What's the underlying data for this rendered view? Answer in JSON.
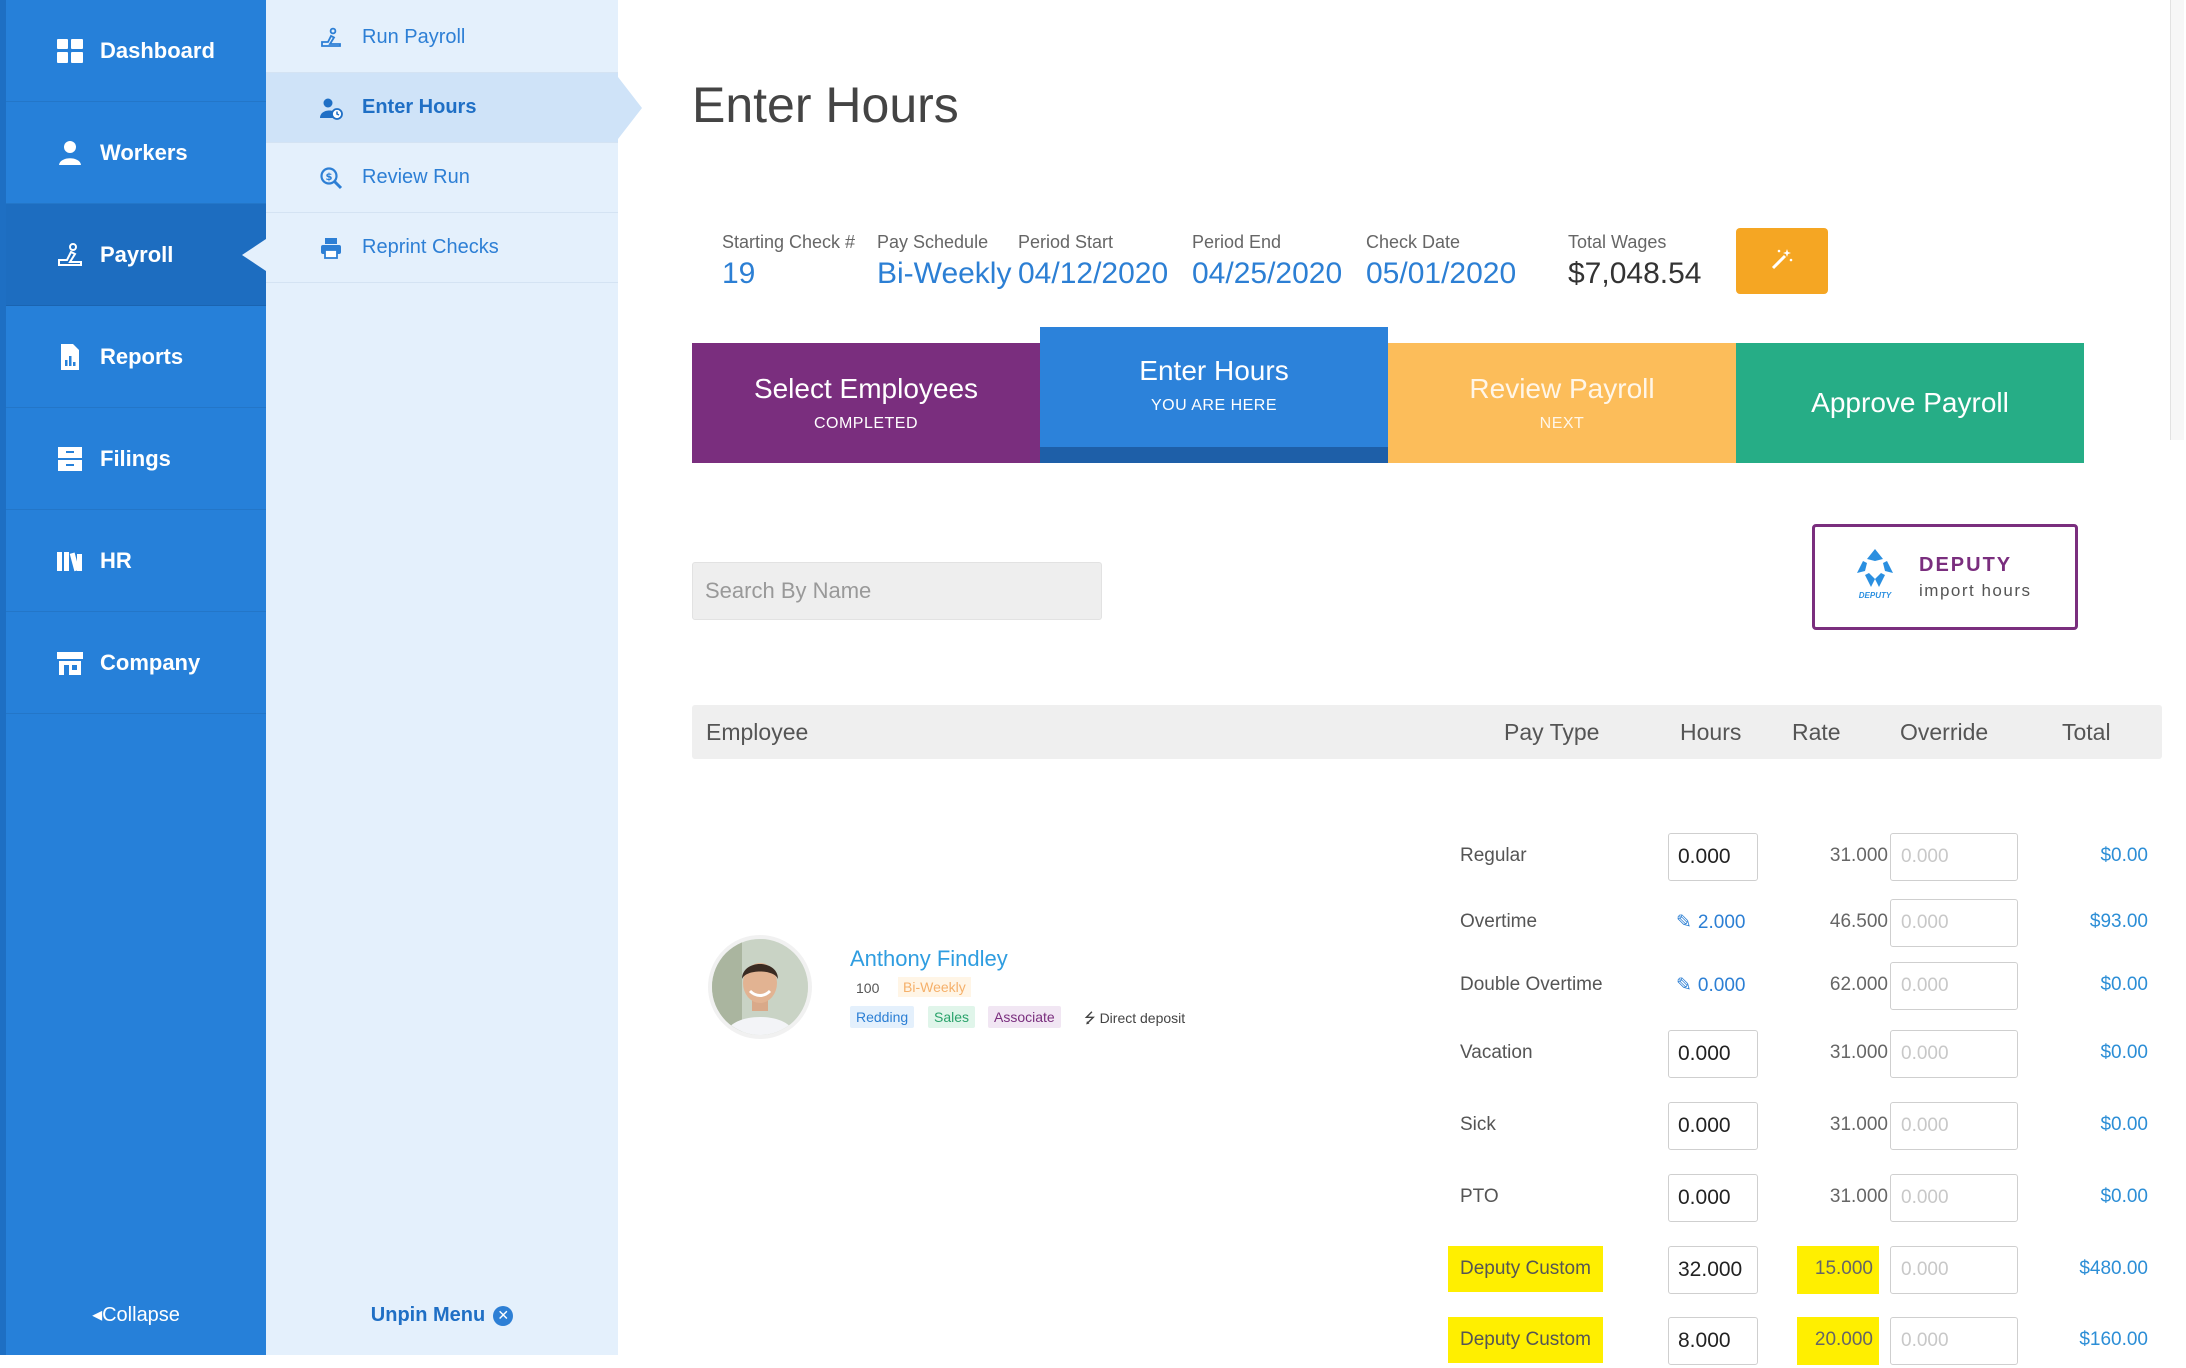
{
  "sidebar": {
    "items": [
      {
        "label": "Dashboard",
        "icon": "dashboard-icon"
      },
      {
        "label": "Workers",
        "icon": "workers-icon"
      },
      {
        "label": "Payroll",
        "icon": "payroll-icon",
        "active": true
      },
      {
        "label": "Reports",
        "icon": "reports-icon"
      },
      {
        "label": "Filings",
        "icon": "filings-icon"
      },
      {
        "label": "HR",
        "icon": "hr-icon"
      },
      {
        "label": "Company",
        "icon": "company-icon"
      }
    ],
    "collapse_label": "Collapse"
  },
  "subnav": {
    "items": [
      {
        "label": "Run Payroll",
        "icon": "run-payroll-icon"
      },
      {
        "label": "Enter Hours",
        "icon": "enter-hours-icon",
        "active": true
      },
      {
        "label": "Review Run",
        "icon": "review-run-icon"
      },
      {
        "label": "Reprint Checks",
        "icon": "printer-icon"
      }
    ],
    "unpin_label": "Unpin Menu"
  },
  "page": {
    "title": "Enter Hours"
  },
  "summary": {
    "starting_check": {
      "label": "Starting Check #",
      "value": "19"
    },
    "pay_schedule": {
      "label": "Pay Schedule",
      "value": "Bi-Weekly"
    },
    "period_start": {
      "label": "Period Start",
      "value": "04/12/2020"
    },
    "period_end": {
      "label": "Period End",
      "value": "04/25/2020"
    },
    "check_date": {
      "label": "Check Date",
      "value": "05/01/2020"
    },
    "total_wages": {
      "label": "Total Wages",
      "value": "$7,048.54"
    }
  },
  "steps": [
    {
      "title": "Select Employees",
      "subtitle": "COMPLETED",
      "color": "#7a2e7e"
    },
    {
      "title": "Enter Hours",
      "subtitle": "YOU ARE HERE",
      "color": "#2c82da"
    },
    {
      "title": "Review Payroll",
      "subtitle": "NEXT",
      "color": "#fcbd5a"
    },
    {
      "title": "Approve Payroll",
      "subtitle": "",
      "color": "#26ad86"
    }
  ],
  "search": {
    "placeholder": "Search By Name",
    "value": ""
  },
  "deputy": {
    "name": "DEPUTY",
    "subtitle": "import hours",
    "logo_text": "DEPUTY"
  },
  "table": {
    "headers": {
      "employee": "Employee",
      "pay_type": "Pay Type",
      "hours": "Hours",
      "rate": "Rate",
      "override": "Override",
      "total": "Total"
    }
  },
  "employee": {
    "name": "Anthony Findley",
    "id": "100",
    "schedule": "Bi-Weekly",
    "tags": [
      "Redding",
      "Sales",
      "Associate"
    ],
    "payment_method": "Direct deposit"
  },
  "pay_rows": [
    {
      "type": "Regular",
      "hours": "0.000",
      "editable": true,
      "rate": "31.000",
      "override_placeholder": "0.000",
      "total": "$0.00",
      "highlight": false
    },
    {
      "type": "Overtime",
      "hours": "2.000",
      "editable": false,
      "rate": "46.500",
      "override_placeholder": "0.000",
      "total": "$93.00",
      "highlight": false
    },
    {
      "type": "Double Overtime",
      "hours": "0.000",
      "editable": false,
      "rate": "62.000",
      "override_placeholder": "0.000",
      "total": "$0.00",
      "highlight": false
    },
    {
      "type": "Vacation",
      "hours": "0.000",
      "editable": true,
      "rate": "31.000",
      "override_placeholder": "0.000",
      "total": "$0.00",
      "highlight": false
    },
    {
      "type": "Sick",
      "hours": "0.000",
      "editable": true,
      "rate": "31.000",
      "override_placeholder": "0.000",
      "total": "$0.00",
      "highlight": false
    },
    {
      "type": "PTO",
      "hours": "0.000",
      "editable": true,
      "rate": "31.000",
      "override_placeholder": "0.000",
      "total": "$0.00",
      "highlight": false
    },
    {
      "type": "Deputy Custom",
      "hours": "32.000",
      "editable": true,
      "rate": "15.000",
      "override_placeholder": "0.000",
      "total": "$480.00",
      "highlight": true
    },
    {
      "type": "Deputy Custom",
      "hours": "8.000",
      "editable": true,
      "rate": "20.000",
      "override_placeholder": "0.000",
      "total": "$160.00",
      "highlight": true
    }
  ],
  "colors": {
    "sidebar": "#2680d9",
    "subnav": "#e4f0fc",
    "accent": "#2c7fd4",
    "highlight": "#ffef00",
    "magic_button": "#f5a623",
    "deputy": "#7a2e7e"
  }
}
